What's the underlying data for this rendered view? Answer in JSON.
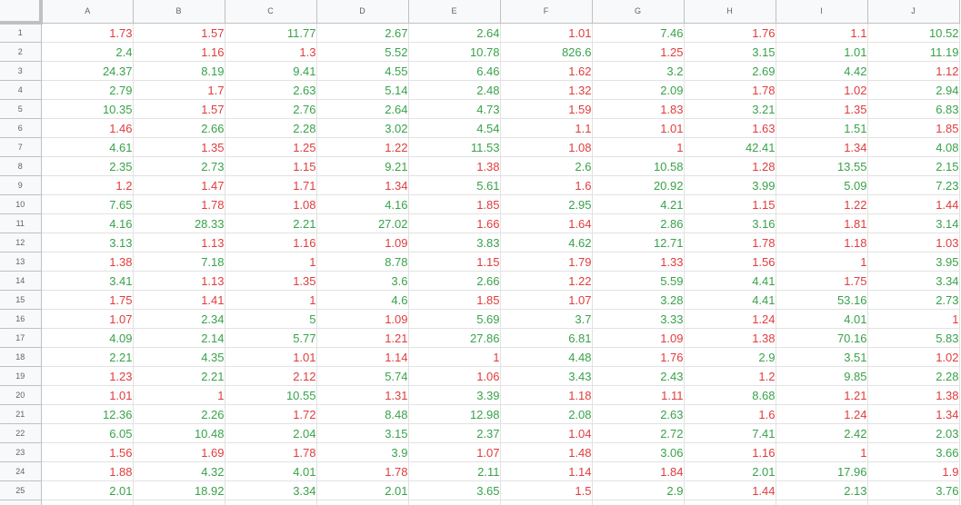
{
  "columns": [
    "A",
    "B",
    "C",
    "D",
    "E",
    "F",
    "G",
    "H",
    "I",
    "J"
  ],
  "colors": {
    "up": "#38a24a",
    "down": "#e03c3c",
    "header_bg": "#f8f9fa",
    "gridline": "#e2e2e2"
  },
  "rows": [
    {
      "n": "1",
      "cells": [
        [
          "1.73",
          "d"
        ],
        [
          "1.57",
          "d"
        ],
        [
          "11.77",
          "u"
        ],
        [
          "2.67",
          "u"
        ],
        [
          "2.64",
          "u"
        ],
        [
          "1.01",
          "d"
        ],
        [
          "7.46",
          "u"
        ],
        [
          "1.76",
          "d"
        ],
        [
          "1.1",
          "d"
        ],
        [
          "10.52",
          "u"
        ]
      ]
    },
    {
      "n": "2",
      "cells": [
        [
          "2.4",
          "u"
        ],
        [
          "1.16",
          "d"
        ],
        [
          "1.3",
          "d"
        ],
        [
          "5.52",
          "u"
        ],
        [
          "10.78",
          "u"
        ],
        [
          "826.6",
          "u"
        ],
        [
          "1.25",
          "d"
        ],
        [
          "3.15",
          "u"
        ],
        [
          "1.01",
          "u"
        ],
        [
          "11.19",
          "u"
        ]
      ]
    },
    {
      "n": "3",
      "cells": [
        [
          "24.37",
          "u"
        ],
        [
          "8.19",
          "u"
        ],
        [
          "9.41",
          "u"
        ],
        [
          "4.55",
          "u"
        ],
        [
          "6.46",
          "u"
        ],
        [
          "1.62",
          "d"
        ],
        [
          "3.2",
          "u"
        ],
        [
          "2.69",
          "u"
        ],
        [
          "4.42",
          "u"
        ],
        [
          "1.12",
          "d"
        ]
      ]
    },
    {
      "n": "4",
      "cells": [
        [
          "2.79",
          "u"
        ],
        [
          "1.7",
          "d"
        ],
        [
          "2.63",
          "u"
        ],
        [
          "5.14",
          "u"
        ],
        [
          "2.48",
          "u"
        ],
        [
          "1.32",
          "d"
        ],
        [
          "2.09",
          "u"
        ],
        [
          "1.78",
          "d"
        ],
        [
          "1.02",
          "d"
        ],
        [
          "2.94",
          "u"
        ]
      ]
    },
    {
      "n": "5",
      "cells": [
        [
          "10.35",
          "u"
        ],
        [
          "1.57",
          "d"
        ],
        [
          "2.76",
          "u"
        ],
        [
          "2.64",
          "u"
        ],
        [
          "4.73",
          "u"
        ],
        [
          "1.59",
          "d"
        ],
        [
          "1.83",
          "d"
        ],
        [
          "3.21",
          "u"
        ],
        [
          "1.35",
          "d"
        ],
        [
          "6.83",
          "u"
        ]
      ]
    },
    {
      "n": "6",
      "cells": [
        [
          "1.46",
          "d"
        ],
        [
          "2.66",
          "u"
        ],
        [
          "2.28",
          "u"
        ],
        [
          "3.02",
          "u"
        ],
        [
          "4.54",
          "u"
        ],
        [
          "1.1",
          "d"
        ],
        [
          "1.01",
          "d"
        ],
        [
          "1.63",
          "d"
        ],
        [
          "1.51",
          "u"
        ],
        [
          "1.85",
          "d"
        ]
      ]
    },
    {
      "n": "7",
      "cells": [
        [
          "4.61",
          "u"
        ],
        [
          "1.35",
          "d"
        ],
        [
          "1.25",
          "d"
        ],
        [
          "1.22",
          "d"
        ],
        [
          "11.53",
          "u"
        ],
        [
          "1.08",
          "d"
        ],
        [
          "1",
          "d"
        ],
        [
          "42.41",
          "u"
        ],
        [
          "1.34",
          "d"
        ],
        [
          "4.08",
          "u"
        ]
      ]
    },
    {
      "n": "8",
      "cells": [
        [
          "2.35",
          "u"
        ],
        [
          "2.73",
          "u"
        ],
        [
          "1.15",
          "d"
        ],
        [
          "9.21",
          "u"
        ],
        [
          "1.38",
          "d"
        ],
        [
          "2.6",
          "u"
        ],
        [
          "10.58",
          "u"
        ],
        [
          "1.28",
          "d"
        ],
        [
          "13.55",
          "u"
        ],
        [
          "2.15",
          "u"
        ]
      ]
    },
    {
      "n": "9",
      "cells": [
        [
          "1.2",
          "d"
        ],
        [
          "1.47",
          "d"
        ],
        [
          "1.71",
          "d"
        ],
        [
          "1.34",
          "d"
        ],
        [
          "5.61",
          "u"
        ],
        [
          "1.6",
          "d"
        ],
        [
          "20.92",
          "u"
        ],
        [
          "3.99",
          "u"
        ],
        [
          "5.09",
          "u"
        ],
        [
          "7.23",
          "u"
        ]
      ]
    },
    {
      "n": "10",
      "cells": [
        [
          "7.65",
          "u"
        ],
        [
          "1.78",
          "d"
        ],
        [
          "1.08",
          "d"
        ],
        [
          "4.16",
          "u"
        ],
        [
          "1.85",
          "d"
        ],
        [
          "2.95",
          "u"
        ],
        [
          "4.21",
          "u"
        ],
        [
          "1.15",
          "d"
        ],
        [
          "1.22",
          "d"
        ],
        [
          "1.44",
          "d"
        ]
      ]
    },
    {
      "n": "11",
      "cells": [
        [
          "4.16",
          "u"
        ],
        [
          "28.33",
          "u"
        ],
        [
          "2.21",
          "u"
        ],
        [
          "27.02",
          "u"
        ],
        [
          "1.66",
          "d"
        ],
        [
          "1.64",
          "d"
        ],
        [
          "2.86",
          "u"
        ],
        [
          "3.16",
          "u"
        ],
        [
          "1.81",
          "d"
        ],
        [
          "3.14",
          "u"
        ]
      ]
    },
    {
      "n": "12",
      "cells": [
        [
          "3.13",
          "u"
        ],
        [
          "1.13",
          "d"
        ],
        [
          "1.16",
          "d"
        ],
        [
          "1.09",
          "d"
        ],
        [
          "3.83",
          "u"
        ],
        [
          "4.62",
          "u"
        ],
        [
          "12.71",
          "u"
        ],
        [
          "1.78",
          "d"
        ],
        [
          "1.18",
          "d"
        ],
        [
          "1.03",
          "d"
        ]
      ]
    },
    {
      "n": "13",
      "cells": [
        [
          "1.38",
          "d"
        ],
        [
          "7.18",
          "u"
        ],
        [
          "1",
          "d"
        ],
        [
          "8.78",
          "u"
        ],
        [
          "1.15",
          "d"
        ],
        [
          "1.79",
          "d"
        ],
        [
          "1.33",
          "d"
        ],
        [
          "1.56",
          "d"
        ],
        [
          "1",
          "d"
        ],
        [
          "3.95",
          "u"
        ]
      ]
    },
    {
      "n": "14",
      "cells": [
        [
          "3.41",
          "u"
        ],
        [
          "1.13",
          "d"
        ],
        [
          "1.35",
          "d"
        ],
        [
          "3.6",
          "u"
        ],
        [
          "2.66",
          "u"
        ],
        [
          "1.22",
          "d"
        ],
        [
          "5.59",
          "u"
        ],
        [
          "4.41",
          "u"
        ],
        [
          "1.75",
          "d"
        ],
        [
          "3.34",
          "u"
        ]
      ]
    },
    {
      "n": "15",
      "cells": [
        [
          "1.75",
          "d"
        ],
        [
          "1.41",
          "d"
        ],
        [
          "1",
          "d"
        ],
        [
          "4.6",
          "u"
        ],
        [
          "1.85",
          "d"
        ],
        [
          "1.07",
          "d"
        ],
        [
          "3.28",
          "u"
        ],
        [
          "4.41",
          "u"
        ],
        [
          "53.16",
          "u"
        ],
        [
          "2.73",
          "u"
        ]
      ]
    },
    {
      "n": "16",
      "cells": [
        [
          "1.07",
          "d"
        ],
        [
          "2.34",
          "u"
        ],
        [
          "5",
          "u"
        ],
        [
          "1.09",
          "d"
        ],
        [
          "5.69",
          "u"
        ],
        [
          "3.7",
          "u"
        ],
        [
          "3.33",
          "u"
        ],
        [
          "1.24",
          "d"
        ],
        [
          "4.01",
          "u"
        ],
        [
          "1",
          "d"
        ]
      ]
    },
    {
      "n": "17",
      "cells": [
        [
          "4.09",
          "u"
        ],
        [
          "2.14",
          "u"
        ],
        [
          "5.77",
          "u"
        ],
        [
          "1.21",
          "d"
        ],
        [
          "27.86",
          "u"
        ],
        [
          "6.81",
          "u"
        ],
        [
          "1.09",
          "d"
        ],
        [
          "1.38",
          "d"
        ],
        [
          "70.16",
          "u"
        ],
        [
          "5.83",
          "u"
        ]
      ]
    },
    {
      "n": "18",
      "cells": [
        [
          "2.21",
          "u"
        ],
        [
          "4.35",
          "u"
        ],
        [
          "1.01",
          "d"
        ],
        [
          "1.14",
          "d"
        ],
        [
          "1",
          "d"
        ],
        [
          "4.48",
          "u"
        ],
        [
          "1.76",
          "d"
        ],
        [
          "2.9",
          "u"
        ],
        [
          "3.51",
          "u"
        ],
        [
          "1.02",
          "d"
        ]
      ]
    },
    {
      "n": "19",
      "cells": [
        [
          "1.23",
          "d"
        ],
        [
          "2.21",
          "u"
        ],
        [
          "2.12",
          "d"
        ],
        [
          "5.74",
          "u"
        ],
        [
          "1.06",
          "d"
        ],
        [
          "3.43",
          "u"
        ],
        [
          "2.43",
          "u"
        ],
        [
          "1.2",
          "d"
        ],
        [
          "9.85",
          "u"
        ],
        [
          "2.28",
          "u"
        ]
      ]
    },
    {
      "n": "20",
      "cells": [
        [
          "1.01",
          "d"
        ],
        [
          "1",
          "d"
        ],
        [
          "10.55",
          "u"
        ],
        [
          "1.31",
          "d"
        ],
        [
          "3.39",
          "u"
        ],
        [
          "1.18",
          "d"
        ],
        [
          "1.11",
          "d"
        ],
        [
          "8.68",
          "u"
        ],
        [
          "1.21",
          "d"
        ],
        [
          "1.38",
          "d"
        ]
      ]
    },
    {
      "n": "21",
      "cells": [
        [
          "12.36",
          "u"
        ],
        [
          "2.26",
          "u"
        ],
        [
          "1.72",
          "d"
        ],
        [
          "8.48",
          "u"
        ],
        [
          "12.98",
          "u"
        ],
        [
          "2.08",
          "u"
        ],
        [
          "2.63",
          "u"
        ],
        [
          "1.6",
          "d"
        ],
        [
          "1.24",
          "d"
        ],
        [
          "1.34",
          "d"
        ]
      ]
    },
    {
      "n": "22",
      "cells": [
        [
          "6.05",
          "u"
        ],
        [
          "10.48",
          "u"
        ],
        [
          "2.04",
          "u"
        ],
        [
          "3.15",
          "u"
        ],
        [
          "2.37",
          "u"
        ],
        [
          "1.04",
          "d"
        ],
        [
          "2.72",
          "u"
        ],
        [
          "7.41",
          "u"
        ],
        [
          "2.42",
          "u"
        ],
        [
          "2.03",
          "u"
        ]
      ]
    },
    {
      "n": "23",
      "cells": [
        [
          "1.56",
          "d"
        ],
        [
          "1.69",
          "d"
        ],
        [
          "1.78",
          "d"
        ],
        [
          "3.9",
          "u"
        ],
        [
          "1.07",
          "d"
        ],
        [
          "1.48",
          "d"
        ],
        [
          "3.06",
          "u"
        ],
        [
          "1.16",
          "d"
        ],
        [
          "1",
          "d"
        ],
        [
          "3.66",
          "u"
        ]
      ]
    },
    {
      "n": "24",
      "cells": [
        [
          "1.88",
          "d"
        ],
        [
          "4.32",
          "u"
        ],
        [
          "4.01",
          "u"
        ],
        [
          "1.78",
          "d"
        ],
        [
          "2.11",
          "u"
        ],
        [
          "1.14",
          "d"
        ],
        [
          "1.84",
          "d"
        ],
        [
          "2.01",
          "u"
        ],
        [
          "17.96",
          "u"
        ],
        [
          "1.9",
          "d"
        ]
      ]
    },
    {
      "n": "25",
      "cells": [
        [
          "2.01",
          "u"
        ],
        [
          "18.92",
          "u"
        ],
        [
          "3.34",
          "u"
        ],
        [
          "2.01",
          "u"
        ],
        [
          "3.65",
          "u"
        ],
        [
          "1.5",
          "d"
        ],
        [
          "2.9",
          "u"
        ],
        [
          "1.44",
          "d"
        ],
        [
          "2.13",
          "u"
        ],
        [
          "3.76",
          "u"
        ]
      ]
    }
  ]
}
